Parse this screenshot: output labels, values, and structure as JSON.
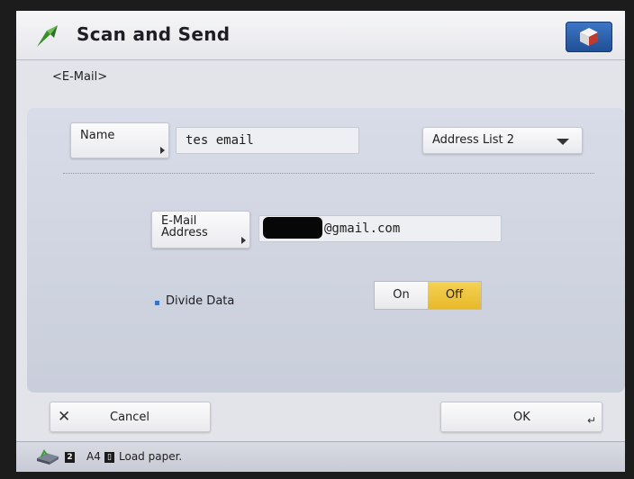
{
  "header": {
    "title": "Scan and Send",
    "app_icon": "scan-send-icon",
    "menu_icon": "cube-menu-icon"
  },
  "breadcrumb": "<E-Mail>",
  "form": {
    "name_label": "Name",
    "name_value": "tes email",
    "address_list_label": "Address List 2",
    "email_label_line1": "E-Mail",
    "email_label_line2": "Address",
    "email_domain": "@gmail.com",
    "divide_data_label": "Divide Data",
    "divide_options": [
      "On",
      "Off"
    ],
    "divide_selected": "Off"
  },
  "footer": {
    "cancel_label": "Cancel",
    "ok_label": "OK"
  },
  "status": {
    "tray_number": "2",
    "paper_size": "A4",
    "message": "Load paper."
  },
  "colors": {
    "accent": "#2a5cab",
    "selected": "#e8b92a"
  }
}
